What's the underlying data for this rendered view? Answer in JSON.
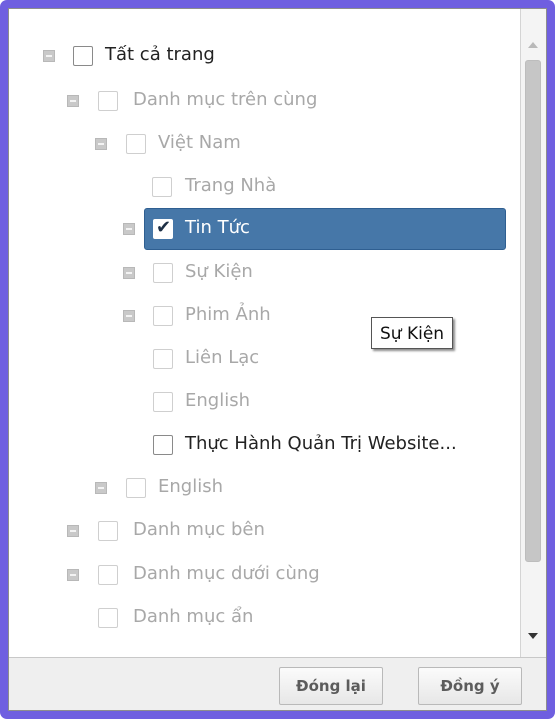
{
  "tree": {
    "items": [
      {
        "label": "Tất cả trang"
      },
      {
        "label": "Danh mục trên cùng"
      },
      {
        "label": "Việt Nam"
      },
      {
        "label": "Trang Nhà"
      },
      {
        "label": "Tin Tức"
      },
      {
        "label": "Sự Kiện"
      },
      {
        "label": "Phim Ảnh"
      },
      {
        "label": "Liên Lạc"
      },
      {
        "label": "English"
      },
      {
        "label": "Thực Hành Quản Trị Website..."
      },
      {
        "label": "English"
      },
      {
        "label": "Danh mục bên"
      },
      {
        "label": "Danh mục dưới cùng"
      },
      {
        "label": "Danh mục ẩn"
      }
    ]
  },
  "tooltip": {
    "text": "Sự Kiện"
  },
  "buttons": {
    "close_label": "Đóng lại",
    "ok_label": "Đồng ý"
  },
  "icons": {
    "expander": "minus-expander-icon",
    "checkbox": "checkbox-icon",
    "check": "checkmark-icon",
    "scroll_up": "scroll-up-arrow-icon",
    "scroll_down": "scroll-down-arrow-icon"
  },
  "colors": {
    "frame": "#6f5fe0",
    "selected_row": "#4677a8"
  }
}
